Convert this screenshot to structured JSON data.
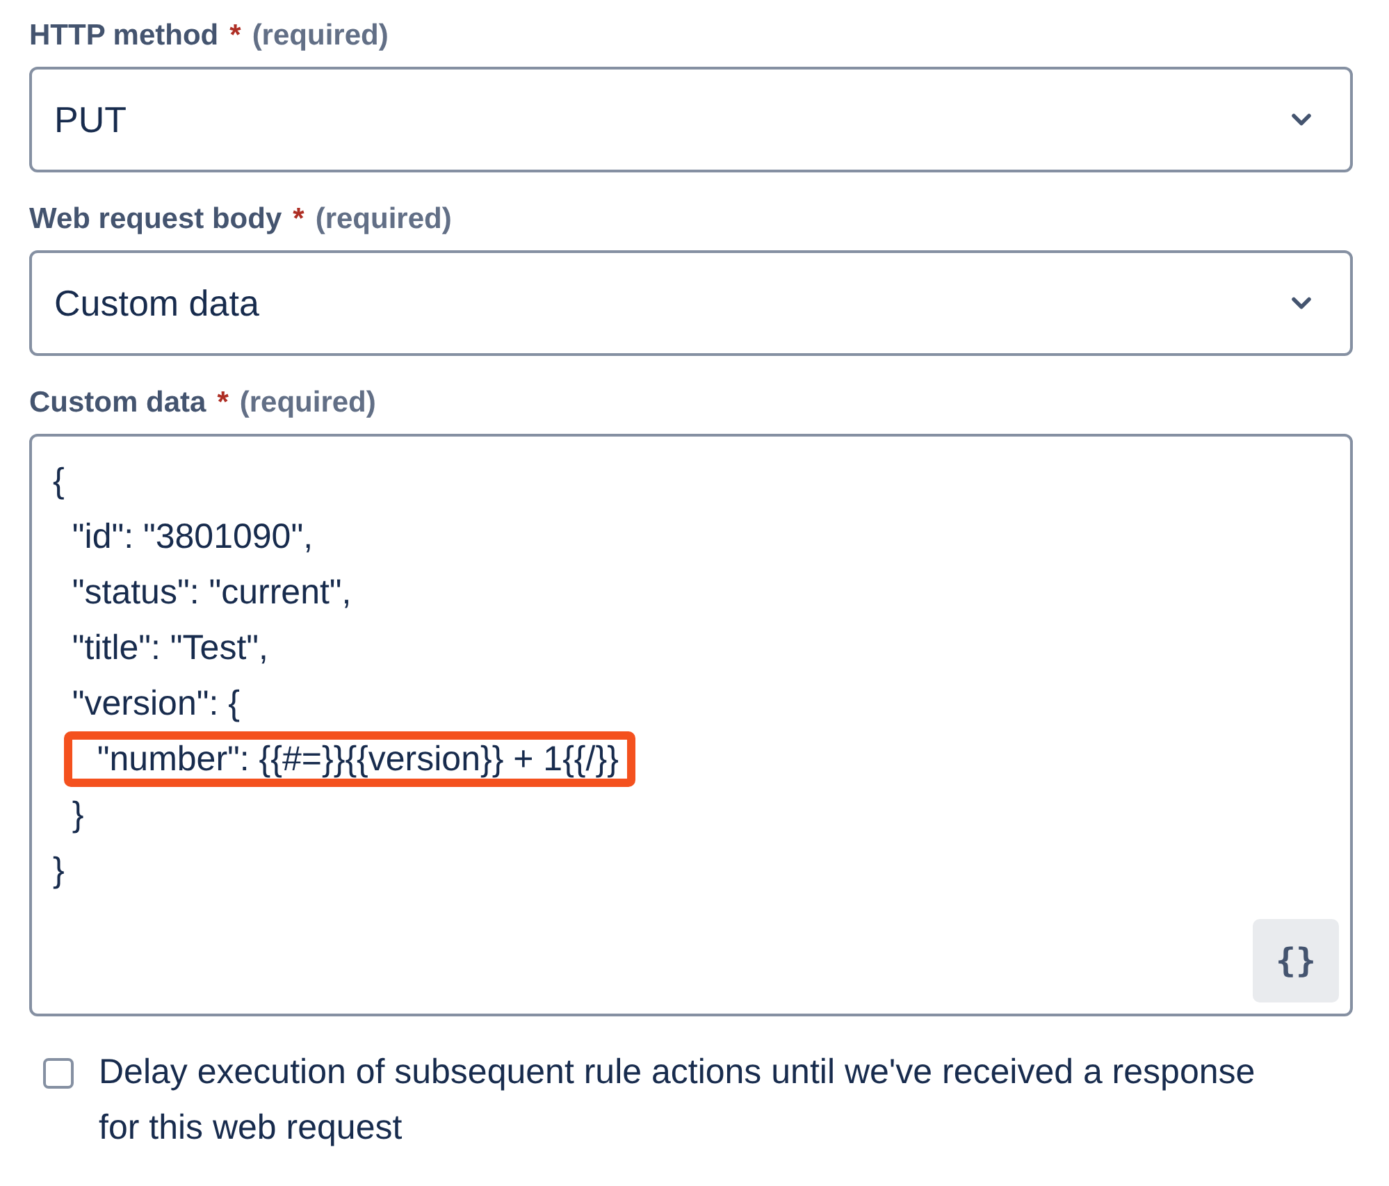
{
  "fields": [
    {
      "kind": "select",
      "label": "HTTP method",
      "required_mark": "*",
      "required_note": "(required)",
      "value": "PUT"
    },
    {
      "kind": "select",
      "label": "Web request body",
      "required_mark": "*",
      "required_note": "(required)",
      "value": "Custom data"
    },
    {
      "kind": "code",
      "label": "Custom data",
      "required_mark": "*",
      "required_note": "(required)",
      "format_button": "{}",
      "lines": [
        {
          "text": "{",
          "highlighted": false
        },
        {
          "text": "  \"id\": \"3801090\",",
          "highlighted": false
        },
        {
          "text": "  \"status\": \"current\",",
          "highlighted": false
        },
        {
          "text": "  \"title\": \"Test\",",
          "highlighted": false
        },
        {
          "text": "  \"version\": {",
          "highlighted": false
        },
        {
          "text": "  \"number\": {{#=}}{{version}} + 1{{/}}",
          "highlighted": true
        },
        {
          "text": "  }",
          "highlighted": false
        },
        {
          "text": "}",
          "highlighted": false
        }
      ]
    }
  ],
  "delay_option": {
    "label": "Delay execution of subsequent rule actions until we've received a response for this web request",
    "checked": false
  }
}
